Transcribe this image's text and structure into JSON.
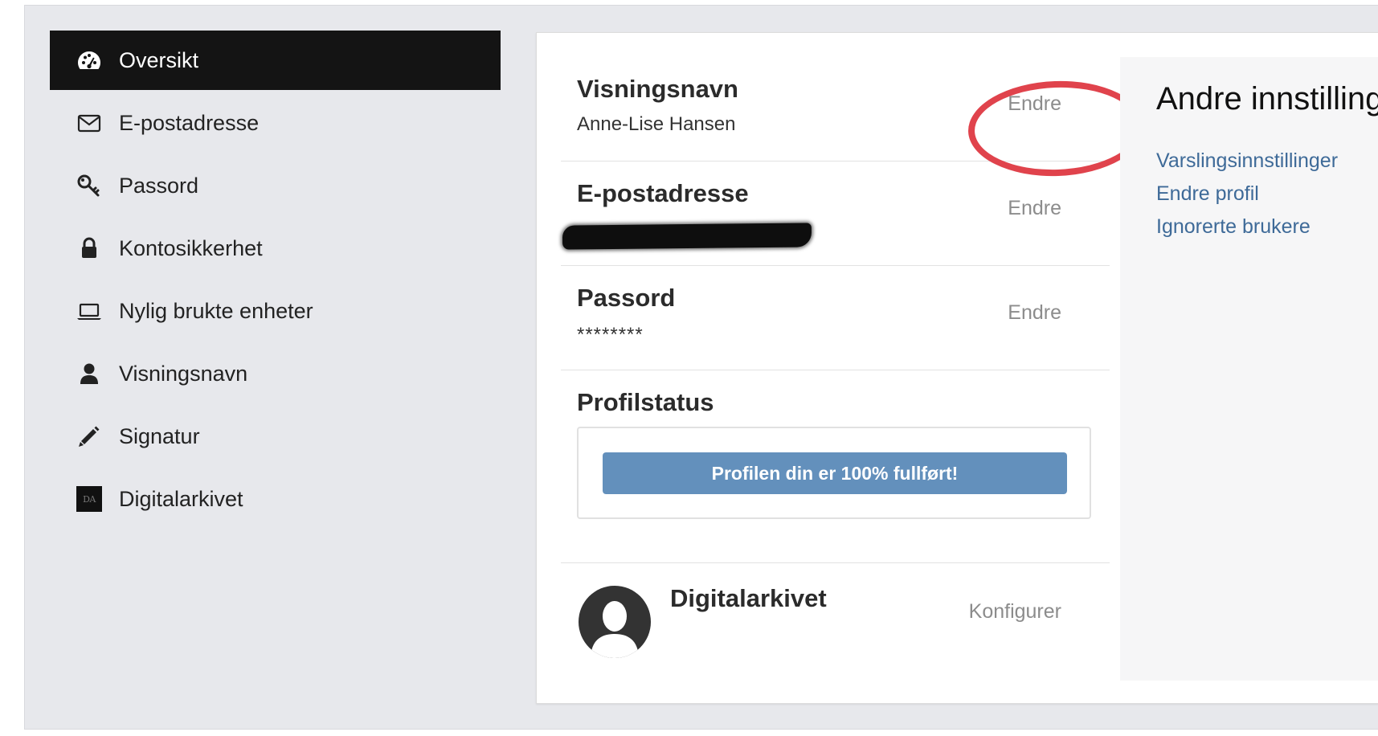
{
  "sidebar": {
    "items": [
      {
        "label": "Oversikt",
        "icon": "dashboard-icon",
        "active": true
      },
      {
        "label": "E-postadresse",
        "icon": "envelope-icon"
      },
      {
        "label": "Passord",
        "icon": "key-icon"
      },
      {
        "label": "Kontosikkerhet",
        "icon": "lock-icon"
      },
      {
        "label": "Nylig brukte enheter",
        "icon": "laptop-icon"
      },
      {
        "label": "Visningsnavn",
        "icon": "user-icon"
      },
      {
        "label": "Signatur",
        "icon": "pencil-icon"
      },
      {
        "label": "Digitalarkivet",
        "icon": "digitalarkivet-logo",
        "logo_text": "DA"
      }
    ]
  },
  "settings": {
    "display_name": {
      "title": "Visningsnavn",
      "value": "Anne-Lise Hansen",
      "action": "Endre"
    },
    "email": {
      "title": "E-postadresse",
      "value_redacted": true,
      "action": "Endre"
    },
    "password": {
      "title": "Passord",
      "value": "********",
      "action": "Endre"
    },
    "profile_status": {
      "title": "Profilstatus",
      "progress_percent": 100,
      "progress_text": "Profilen din er 100% fullført!"
    },
    "digitalarkivet": {
      "title": "Digitalarkivet",
      "action": "Konfigurer"
    }
  },
  "other_settings": {
    "title": "Andre innstillinger",
    "links": [
      "Varslingsinnstillinger",
      "Endre profil",
      "Ignorerte brukere"
    ]
  },
  "colors": {
    "active_nav_bg": "#141414",
    "progress_fill": "#6390bc",
    "link_blue": "#3e6a98",
    "annotation_red": "#e0434c"
  }
}
